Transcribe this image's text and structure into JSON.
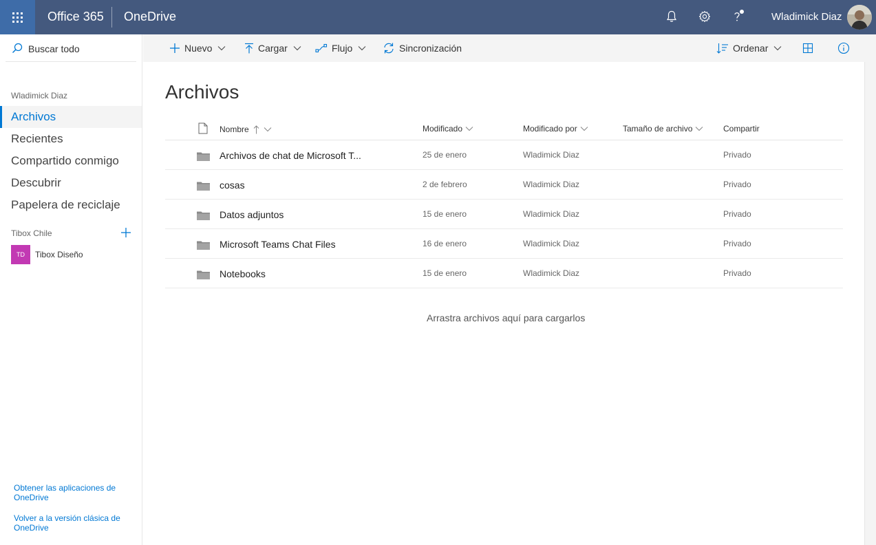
{
  "topbar": {
    "app_name": "Office 365",
    "product_name": "OneDrive",
    "user_name": "Wladimick Diaz",
    "icons": [
      "waffle-icon",
      "bell-icon",
      "gear-icon",
      "help-icon"
    ]
  },
  "leftnav": {
    "search_label": "Buscar todo",
    "section_user": "Wladimick Diaz",
    "items": [
      {
        "label": "Archivos",
        "selected": true
      },
      {
        "label": "Recientes",
        "selected": false
      },
      {
        "label": "Compartido conmigo",
        "selected": false
      },
      {
        "label": "Descubrir",
        "selected": false
      },
      {
        "label": "Papelera de reciclaje",
        "selected": false
      }
    ],
    "section_groups": "Tibox Chile",
    "group": {
      "initials": "TD",
      "label": "Tibox Diseño"
    },
    "footer": {
      "apps_link": "Obtener las aplicaciones de OneDrive",
      "classic_link": "Volver a la versión clásica de OneDrive"
    }
  },
  "cmdbar": {
    "new": "Nuevo",
    "upload": "Cargar",
    "flow": "Flujo",
    "sync": "Sincronización",
    "sort": "Ordenar"
  },
  "main": {
    "title": "Archivos",
    "columns": {
      "name": "Nombre",
      "modified": "Modificado",
      "modified_by": "Modificado por",
      "size": "Tamaño de archivo",
      "share": "Compartir"
    },
    "rows": [
      {
        "name": "Archivos de chat de Microsoft T...",
        "modified": "25 de enero",
        "modified_by": "Wladimick Diaz",
        "share": "Privado"
      },
      {
        "name": "cosas",
        "modified": "2 de febrero",
        "modified_by": "Wladimick Diaz",
        "share": "Privado"
      },
      {
        "name": "Datos adjuntos",
        "modified": "15 de enero",
        "modified_by": "Wladimick Diaz",
        "share": "Privado"
      },
      {
        "name": "Microsoft Teams Chat Files",
        "modified": "16 de enero",
        "modified_by": "Wladimick Diaz",
        "share": "Privado"
      },
      {
        "name": "Notebooks",
        "modified": "15 de enero",
        "modified_by": "Wladimick Diaz",
        "share": "Privado"
      }
    ],
    "dropzone": "Arrastra archivos aquí para cargarlos"
  },
  "colors": {
    "topbar": "#44597e",
    "waffle": "#3e6ca8",
    "accent": "#0078d4",
    "group_tile": "#c239b3"
  }
}
